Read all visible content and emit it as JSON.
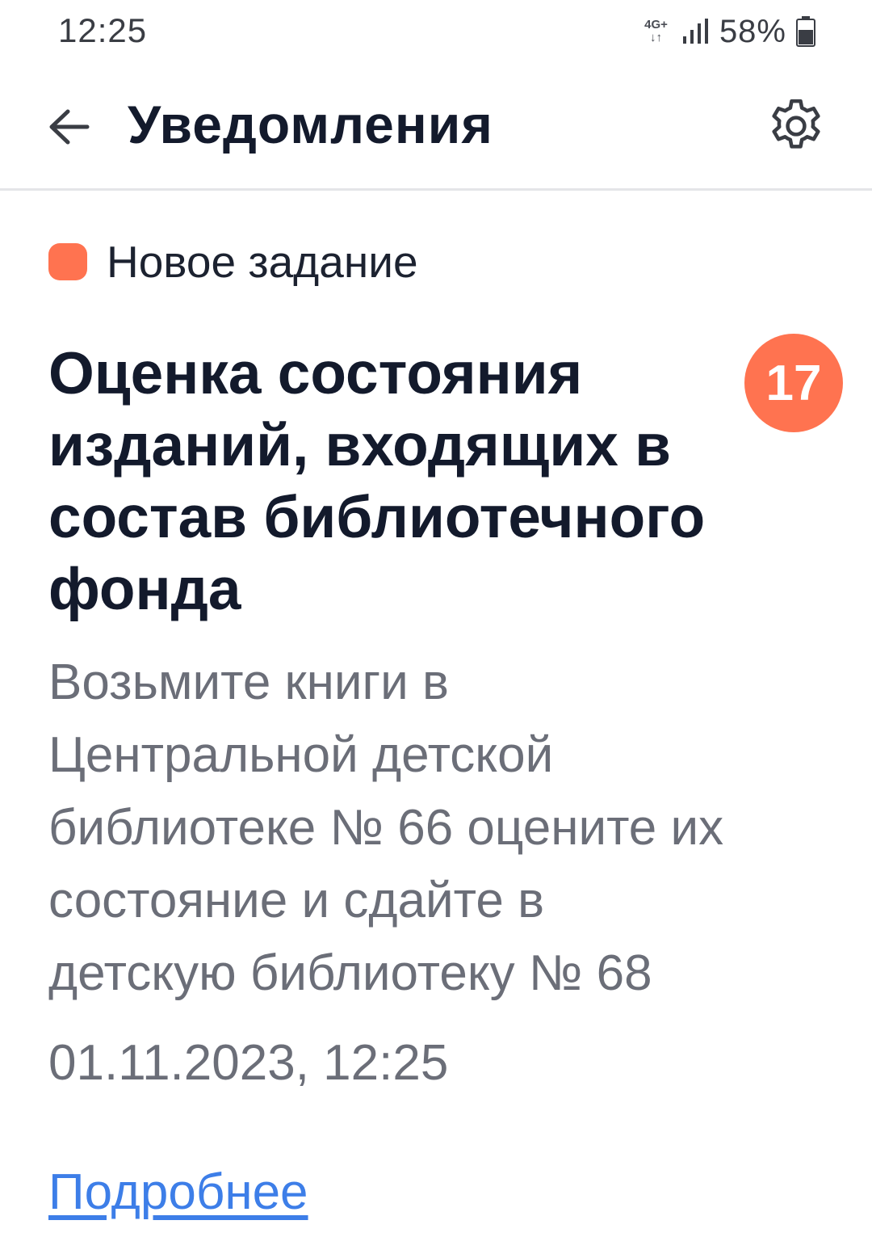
{
  "status_bar": {
    "time": "12:25",
    "network": {
      "label": "4G+",
      "arrows": "↓↑"
    },
    "battery_percent": "58%"
  },
  "header": {
    "title": "Уведомления",
    "back_icon": "arrow-left-icon",
    "settings_icon": "gear-icon"
  },
  "notification": {
    "type_label": "Новое задание",
    "type_color": "#ff7350",
    "title": "Оценка состояния изданий, входящих в состав библиотечного фонда",
    "badge_count": "17",
    "body": "Возьмите книги в Центральной детской библиотеке № 66 оцените их состояние и сдайте в детскую библиотеку № 68",
    "date": "01.11.2023, 12:25",
    "more_link": "Подробнее",
    "link_color": "#3d7ee8"
  }
}
